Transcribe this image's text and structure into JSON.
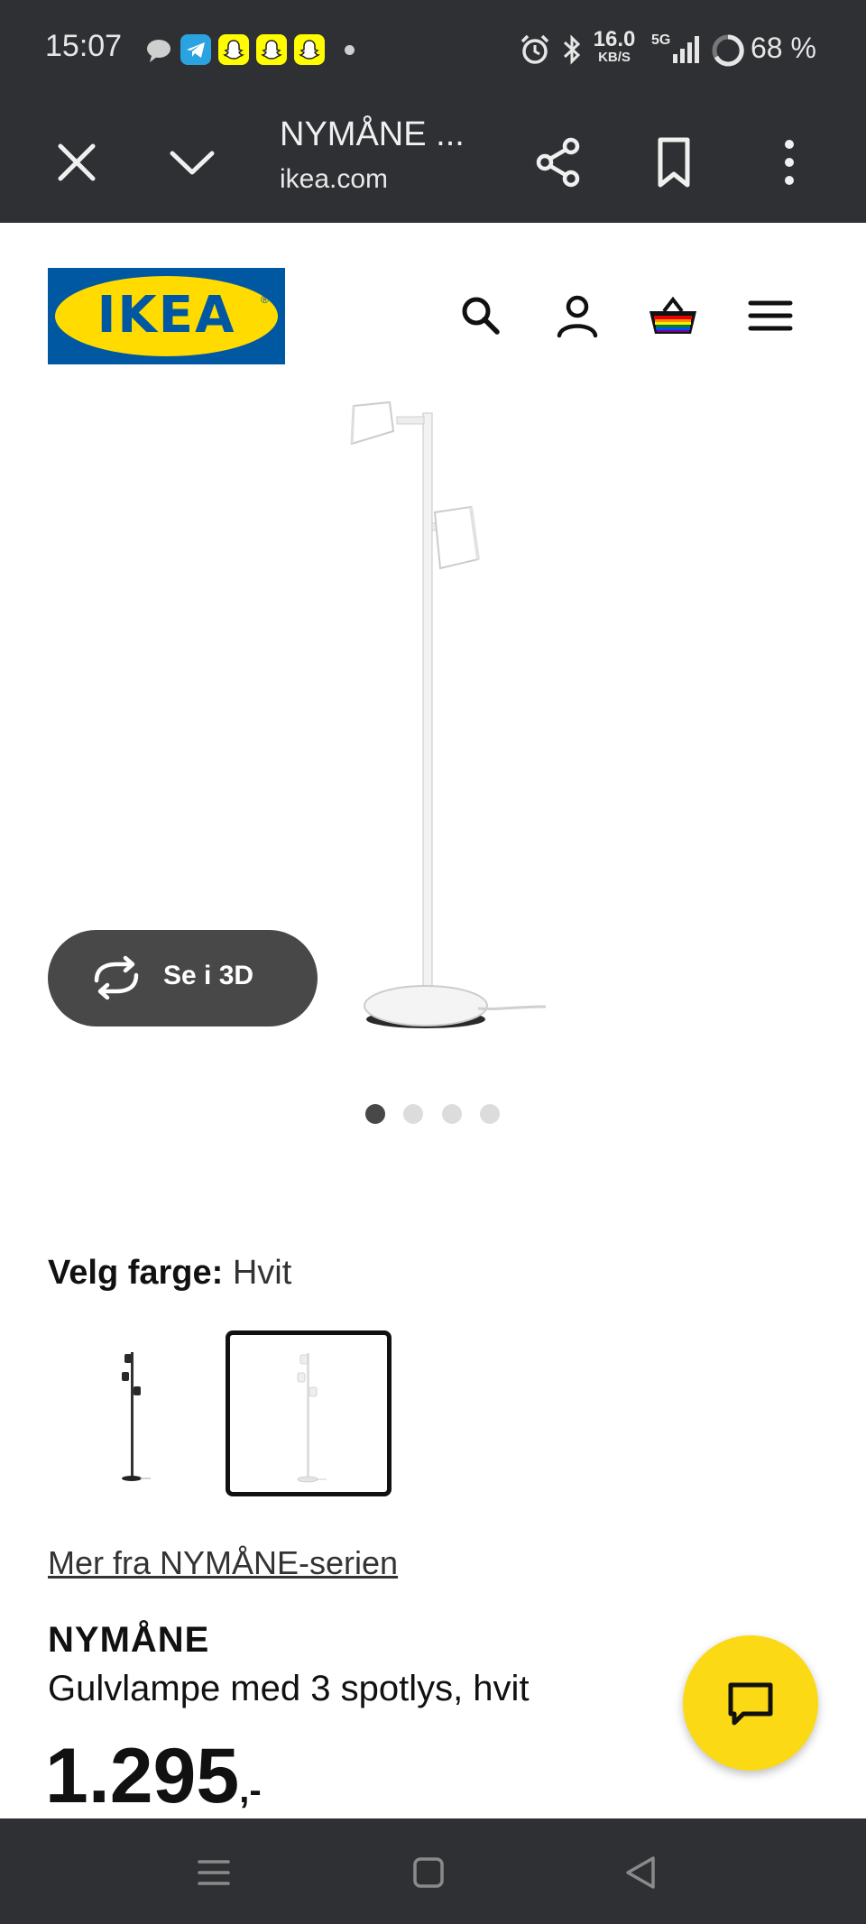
{
  "status_bar": {
    "time": "15:07",
    "network_speed": "16.0",
    "network_unit": "KB/S",
    "network_type": "5G",
    "battery": "68 %"
  },
  "browser": {
    "title": "NYMÅNE ...",
    "domain": "ikea.com"
  },
  "header": {
    "logo_text": "IKEA"
  },
  "gallery": {
    "view_3d_label": "Se i 3D",
    "dots_total": 4,
    "active_dot": 1
  },
  "color": {
    "label": "Velg farge:",
    "value": "Hvit",
    "options": [
      "black",
      "white"
    ],
    "selected": "white"
  },
  "series_link": "Mer fra NYMÅNE-serien",
  "product": {
    "name": "NYMÅNE",
    "description": "Gulvlampe med 3 spotlys, hvit",
    "price_integer": "1.295",
    "price_decimal": ",-"
  },
  "colors": {
    "ikea_blue": "#0058a3",
    "ikea_yellow": "#ffdb00",
    "chat_yellow": "#fbd914",
    "dark_bar": "#2f3033"
  }
}
